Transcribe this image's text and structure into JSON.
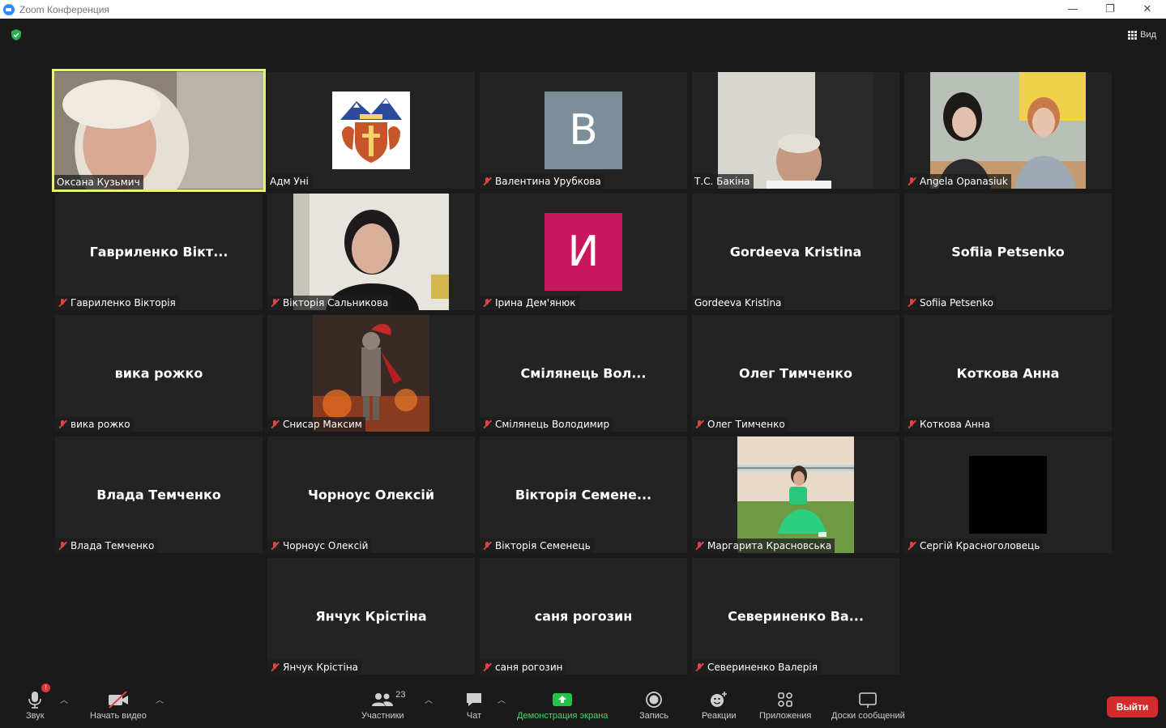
{
  "window": {
    "title": "Zoom Конференция",
    "minimize": "—",
    "restore": "❐",
    "close": "✕"
  },
  "top": {
    "view_label": "Вид"
  },
  "colors": {
    "active_border": "#e8f07a",
    "leave": "#d12b2b",
    "share_green": "#4cd964",
    "mute_red": "#e04444"
  },
  "tiles": [
    {
      "caption": "Оксана Кузьмич",
      "muted": false,
      "kind": "video"
    },
    {
      "caption": "Адм Уні",
      "muted": false,
      "kind": "logo"
    },
    {
      "caption": "Валентина Урубкова",
      "muted": true,
      "kind": "letter",
      "letter": "В",
      "color": "#7b8e99"
    },
    {
      "caption": "Т.С. Бакіна",
      "muted": false,
      "kind": "video"
    },
    {
      "caption": "Angela Opanasiuk",
      "muted": true,
      "kind": "video"
    },
    {
      "caption": "Гавриленко Вікторія",
      "muted": true,
      "kind": "name",
      "display": "Гавриленко  Вікт..."
    },
    {
      "caption": "Вікторія Сальникова",
      "muted": true,
      "kind": "video"
    },
    {
      "caption": "Ірина Дем'янюк",
      "muted": true,
      "kind": "letter",
      "letter": "И",
      "color": "#c8185f"
    },
    {
      "caption": "Gordeeva Kristina",
      "muted": false,
      "kind": "name",
      "display": "Gordeeva Kristina"
    },
    {
      "caption": "Sofiia Petsenko",
      "muted": true,
      "kind": "name",
      "display": "Sofiia Petsenko"
    },
    {
      "caption": "вика рожко",
      "muted": true,
      "kind": "name",
      "display": "вика рожко"
    },
    {
      "caption": "Снисар Максим",
      "muted": true,
      "kind": "image"
    },
    {
      "caption": "Смілянець Володимир",
      "muted": true,
      "kind": "name",
      "display": "Смілянець  Вол..."
    },
    {
      "caption": "Олег Тимченко",
      "muted": true,
      "kind": "name",
      "display": "Олег Тимченко"
    },
    {
      "caption": "Коткова Анна",
      "muted": true,
      "kind": "name",
      "display": "Коткова Анна"
    },
    {
      "caption": "Влада Темченко",
      "muted": true,
      "kind": "name",
      "display": "Влада Темченко"
    },
    {
      "caption": "Чорноус Олексій",
      "muted": true,
      "kind": "name",
      "display": "Чорноус Олексій"
    },
    {
      "caption": "Вікторія Семенець",
      "muted": true,
      "kind": "name",
      "display": "Вікторія  Семене..."
    },
    {
      "caption": "Маргарита Красновська",
      "muted": true,
      "kind": "photo"
    },
    {
      "caption": "Сергій Красноголовець",
      "muted": true,
      "kind": "black"
    },
    {
      "caption": "Янчук Крістіна",
      "muted": true,
      "kind": "name",
      "display": "Янчук Крістіна"
    },
    {
      "caption": "саня рогозин",
      "muted": true,
      "kind": "name",
      "display": "саня рогозин"
    },
    {
      "caption": "Севериненко Валерія",
      "muted": true,
      "kind": "name",
      "display": "Севериненко  Ва..."
    }
  ],
  "toolbar": {
    "audio": "Звук",
    "audio_badge": "!",
    "video": "Начать видео",
    "participants": "Участники",
    "participants_count": "23",
    "chat": "Чат",
    "share": "Демонстрация экрана",
    "record": "Запись",
    "reactions": "Реакции",
    "apps": "Приложения",
    "whiteboards": "Доски сообщений",
    "leave": "Выйти"
  }
}
